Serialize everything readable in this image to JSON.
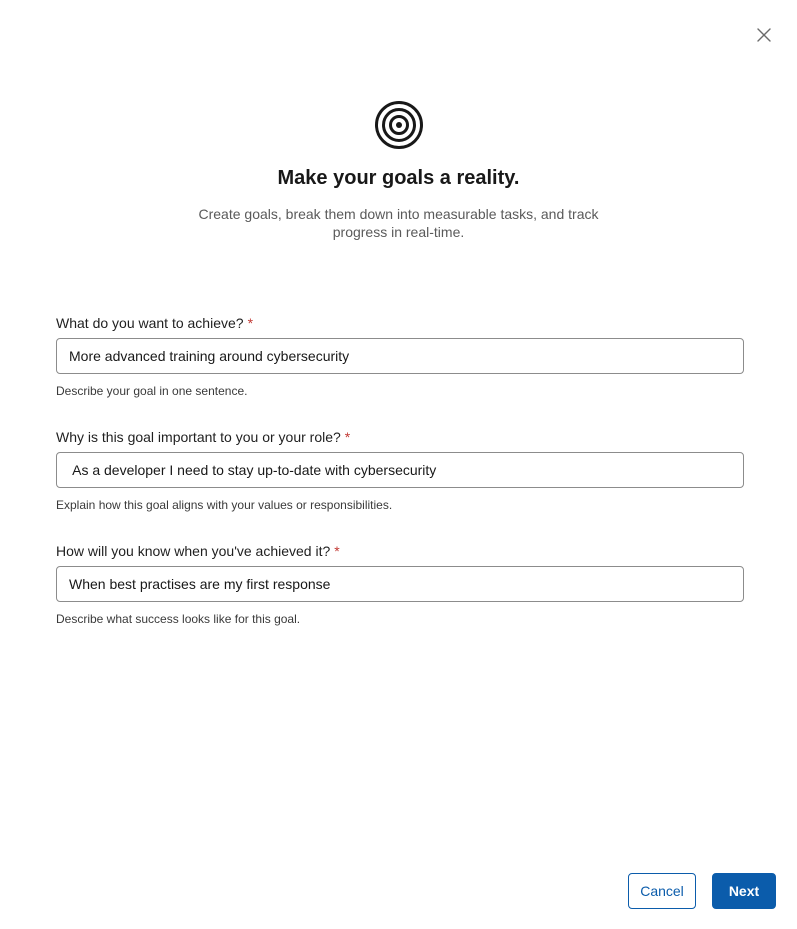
{
  "dialog": {
    "close_icon": "close-icon",
    "hero_icon": "target-icon",
    "title": "Make your goals a reality.",
    "subtitle": "Create goals, break them down into measurable tasks, and track progress in real-time."
  },
  "fields": [
    {
      "label": "What do you want to achieve?",
      "required_mark": "*",
      "value": "More advanced training around cybersecurity",
      "help": "Describe your goal in one sentence."
    },
    {
      "label": "Why is this goal important to you or your role?",
      "required_mark": "*",
      "value": " As a developer I need to stay up-to-date with cybersecurity",
      "help": "Explain how this goal aligns with your values or responsibilities."
    },
    {
      "label": "How will you know when you've achieved it?",
      "required_mark": "*",
      "value": "When best practises are my first response",
      "help": "Describe what success looks like for this goal."
    }
  ],
  "buttons": {
    "cancel": "Cancel",
    "next": "Next"
  },
  "colors": {
    "primary": "#0b5cab",
    "required": "#c23934"
  }
}
